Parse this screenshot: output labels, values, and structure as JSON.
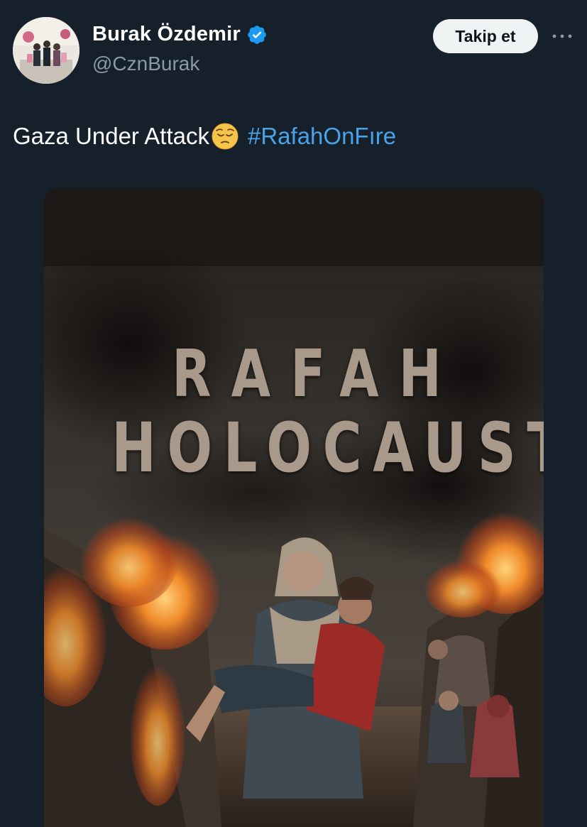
{
  "tweet": {
    "author": {
      "display_name": "Burak Özdemir",
      "handle": "@CznBurak",
      "verified": true,
      "verified_icon": "verified-badge-icon"
    },
    "follow_button_label": "Takip et",
    "more_icon": "more-horizontal-icon",
    "text_before_emoji": "Gaza Under Attack",
    "emoji": "pensive-face-emoji",
    "hashtag": "#RafahOnFıre",
    "media": {
      "poster_title_line1": "RAFAH",
      "poster_title_line2": "HOLOCAUST"
    }
  },
  "colors": {
    "background": "#15202b",
    "hashtag": "#4aa3e8",
    "verified": "#1d9bf0",
    "handle": "#8b98a5",
    "follow_button_bg": "#eff3f4"
  }
}
